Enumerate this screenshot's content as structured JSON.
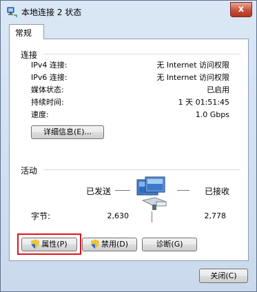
{
  "window": {
    "title": "本地连接 2 状态",
    "close_symbol": "x"
  },
  "tabs": [
    {
      "label": "常规",
      "active": true
    }
  ],
  "connection": {
    "heading": "连接",
    "rows": [
      {
        "label": "IPv4 连接:",
        "value": "无 Internet 访问权限"
      },
      {
        "label": "IPv6 连接:",
        "value": "无 Internet 访问权限"
      },
      {
        "label": "媒体状态:",
        "value": "已启用"
      },
      {
        "label": "持续时间:",
        "value": "1 天 01:51:45"
      },
      {
        "label": "速度:",
        "value": "1.0 Gbps"
      }
    ],
    "details_button": "详细信息(E)..."
  },
  "activity": {
    "heading": "活动",
    "sent_label": "已发送",
    "received_label": "已接收",
    "bytes_label": "字节:",
    "sent_value": "2,630",
    "received_value": "2,778",
    "icon": "network-computer-icon"
  },
  "buttons": {
    "properties": "属性(P)",
    "disable": "禁用(D)",
    "diagnose": "诊断(G)",
    "close": "关闭(C)"
  },
  "colors": {
    "highlight": "#e0111b",
    "window_frame": "#cad9ec"
  }
}
